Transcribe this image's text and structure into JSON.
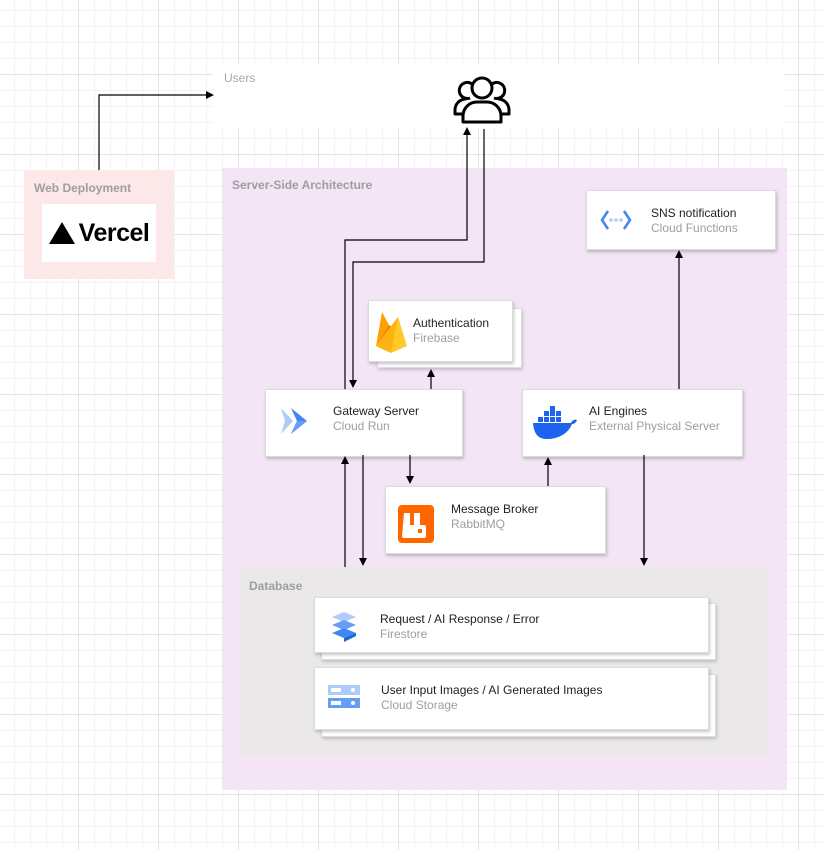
{
  "zones": {
    "users": "Users",
    "web": "Web Deployment",
    "server": "Server-Side Architecture",
    "database": "Database"
  },
  "vercel": {
    "text": "Vercel"
  },
  "nodes": {
    "sns": {
      "title": "SNS notification",
      "subtitle": "Cloud Functions"
    },
    "auth": {
      "title": "Authentication",
      "subtitle": "Firebase"
    },
    "gateway": {
      "title": "Gateway Server",
      "subtitle": "Cloud Run"
    },
    "ai": {
      "title": "AI Engines",
      "subtitle": "External Physical Server"
    },
    "broker": {
      "title": "Message Broker",
      "subtitle": "RabbitMQ"
    },
    "firestore": {
      "title": "Request / AI Response / Error",
      "subtitle": "Firestore"
    },
    "storage": {
      "title": "User Input Images / AI Generated Images",
      "subtitle": "Cloud Storage"
    }
  },
  "icons": {
    "users": "users-icon",
    "vercel": "vercel-triangle-icon",
    "sns": "cloud-functions-icon",
    "auth": "firebase-icon",
    "gateway": "cloud-run-icon",
    "ai": "docker-icon",
    "broker": "rabbitmq-icon",
    "firestore": "firestore-icon",
    "storage": "cloud-storage-icon"
  },
  "colors": {
    "web_zone": "#fce8e8",
    "server_zone": "#f3e5f5",
    "database_zone": "#ebe8e9",
    "google_blue": "#4285f4",
    "docker_blue": "#1d63ed",
    "rabbitmq_orange": "#ff6600",
    "firebase_orange": "#ffa000"
  }
}
